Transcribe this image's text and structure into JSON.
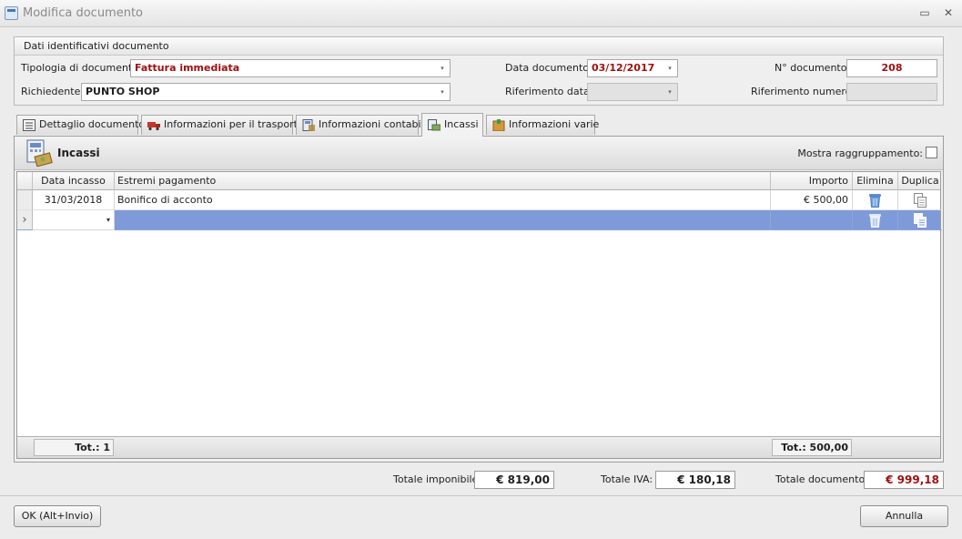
{
  "window": {
    "title": "Modifica documento",
    "restore_glyph": "▭",
    "close_glyph": "✕"
  },
  "group": {
    "title": "Dati identificativi documento",
    "tipologia_label": "Tipologia di documento:",
    "tipologia_value": "Fattura immediata",
    "richiedente_label": "Richiedente:",
    "richiedente_value": "PUNTO SHOP",
    "data_label": "Data documento:",
    "data_value": "03/12/2017",
    "rif_data_label": "Riferimento data:",
    "rif_data_value": "",
    "numero_label": "N° documento:",
    "numero_value": "208",
    "rif_numero_label": "Riferimento numero:",
    "rif_numero_value": ""
  },
  "tabs": [
    {
      "label": "Dettaglio documento",
      "icon": "list-icon"
    },
    {
      "label": "Informazioni per il trasporto",
      "icon": "truck-icon"
    },
    {
      "label": "Informazioni contabili",
      "icon": "calculator-icon"
    },
    {
      "label": "Incassi",
      "icon": "cash-icon",
      "active": true
    },
    {
      "label": "Informazioni varie",
      "icon": "box-icon"
    }
  ],
  "panel": {
    "title": "Incassi",
    "mostra_label": "Mostra raggruppamento:",
    "mostra_checked": false
  },
  "grid": {
    "columns": [
      "Data incasso",
      "Estremi pagamento",
      "Importo",
      "Elimina",
      "Duplica"
    ],
    "rows": [
      {
        "data": "31/03/2018",
        "estremi": "Bonifico di acconto",
        "importo": "€ 500,00"
      },
      {
        "data": "",
        "estremi": "",
        "importo": ""
      }
    ],
    "footer_count": "Tot.: 1",
    "footer_total": "Tot.: 500,00",
    "new_row_glyph": "▾",
    "indicator_glyph": "›"
  },
  "totals": {
    "imponibile_label": "Totale imponibile:",
    "imponibile_value": "€ 819,00",
    "iva_label": "Totale IVA:",
    "iva_value": "€ 180,18",
    "documento_label": "Totale documento:",
    "documento_value": "€ 999,18"
  },
  "buttons": {
    "ok": "OK (Alt+Invio)",
    "annulla": "Annulla"
  },
  "dropdown_glyph": "▾",
  "colors": {
    "accent_red": "#a01010",
    "selection": "#7e9ad8"
  }
}
